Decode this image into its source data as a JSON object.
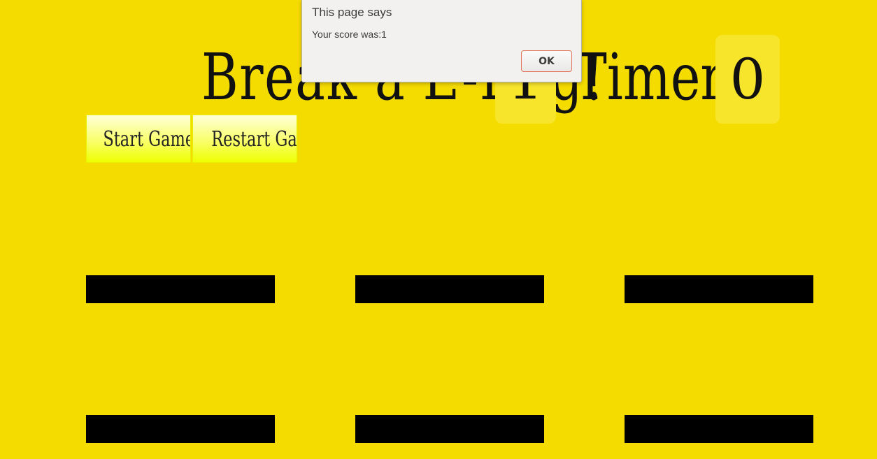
{
  "header": {
    "title": "Break a E-Egg!",
    "score_value": "1",
    "timer_label": "Timer:",
    "timer_value": "0"
  },
  "buttons": {
    "start_label": "Start Game!",
    "restart_label": "Restart Game"
  },
  "board": {
    "hole_count": 6,
    "hole_color": "#000000"
  },
  "alert": {
    "title": "This page says",
    "message": "Your score was:1",
    "ok_label": "OK"
  },
  "colors": {
    "background": "#f5dc00",
    "score_box": "#f7e52b",
    "button_gradient_bottom": "#eeff00"
  }
}
